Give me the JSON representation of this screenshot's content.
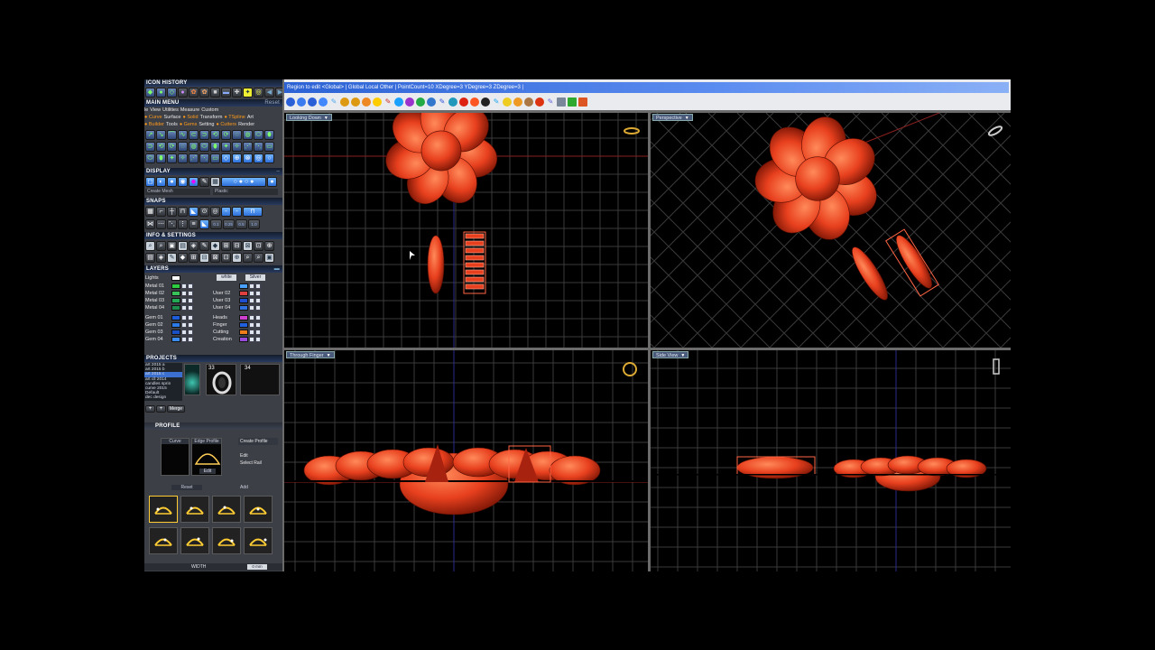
{
  "left_panel": {
    "icon_history": "ICON HISTORY",
    "main_menu": "MAIN MENU",
    "main_menu_reset": "Reset",
    "menu_row_1": [
      "le",
      "View",
      "Utilities",
      "Measure",
      "Custom"
    ],
    "menu_row_2": [
      {
        "label": "Curve",
        "accent": true
      },
      {
        "label": "Surface",
        "accent": false
      },
      {
        "label": "Solid",
        "accent": true
      },
      {
        "label": "Transform",
        "accent": false
      },
      {
        "label": "TSpline",
        "accent": true
      },
      {
        "label": "Art",
        "accent": false
      }
    ],
    "menu_row_3": [
      {
        "label": "Builder",
        "accent": true
      },
      {
        "label": "Tools",
        "accent": false
      },
      {
        "label": "Gems",
        "accent": true
      },
      {
        "label": "Setting",
        "accent": false
      },
      {
        "label": "Cutters",
        "accent": true
      },
      {
        "label": "Render",
        "accent": false
      }
    ],
    "display": "DISPLAY",
    "display_mode_1": "Create Mesh",
    "display_mode_2": "Plastic",
    "snaps": "SNAPS",
    "snap_values": [
      "0.1",
      "0.25",
      "0.5",
      "1.0"
    ],
    "info_settings": "INFO & SETTINGS",
    "layers_header": "LAYERS",
    "layer_lights": "Lights",
    "layer_lights_white": "white",
    "layer_lights_silver": "Silver",
    "layers_left": [
      {
        "name": "Metal 01",
        "color": "#2ecc40"
      },
      {
        "name": "Metal 02",
        "color": "#3ac25a"
      },
      {
        "name": "Metal 03",
        "color": "#22aa55"
      },
      {
        "name": "Metal 04",
        "color": "#1e8c4c"
      },
      {
        "name": "Gem 01",
        "color": "#1c5cd8"
      },
      {
        "name": "Gem 02",
        "color": "#2a7ae8"
      },
      {
        "name": "Gem 03",
        "color": "#1a4fc4"
      },
      {
        "name": "Gem 04",
        "color": "#3a8cf0"
      }
    ],
    "layers_right": [
      {
        "name": "",
        "color": "#4aa0ff"
      },
      {
        "name": "User 02",
        "color": "#e04040"
      },
      {
        "name": "User 03",
        "color": "#2050d0"
      },
      {
        "name": "User 04",
        "color": "#3070e0"
      },
      {
        "name": "Heads",
        "color": "#d040d0"
      },
      {
        "name": "Finger",
        "color": "#2060e0"
      },
      {
        "name": "Cutting",
        "color": "#f07c1a"
      },
      {
        "name": "Creation",
        "color": "#9a4ad8"
      }
    ],
    "projects_header": "PROJECTS",
    "projects": [
      "art 2015 a",
      "art 2015 b",
      "art 2015 c",
      "art cll 2014",
      "candles sprin",
      "curve 2015",
      "Default",
      "dec design"
    ],
    "thumb_numbers": [
      "33",
      "34"
    ],
    "merge_label": "Merge",
    "profile_header": "PROFILE",
    "profile_curve": "Curve",
    "profile_edge": "Edge Profile",
    "create_profile": "Create Profile",
    "profile_edit": "Edit",
    "select_rail": "Select Rail",
    "profile_edit2": "Edit",
    "reset_label": "Reset",
    "add_label": "Add",
    "width_label": "WIDTH",
    "width_value": "0 mm"
  },
  "title_bar": "Region to edit <Global>  |  Global  Local  Other  |  PointCount=10  XDegree=3  YDegree=3  ZDegree=3  |",
  "viewports": {
    "top_left": "Looking Down",
    "top_right": "Perspective",
    "bottom_left": "Through Finger",
    "bottom_right": "Side View"
  },
  "colors": {
    "accent_orange": "#ff9a1a",
    "model_red": "#e8401e",
    "titlebar_blue": "#2c62d4",
    "grid": "#3a3a3a"
  }
}
